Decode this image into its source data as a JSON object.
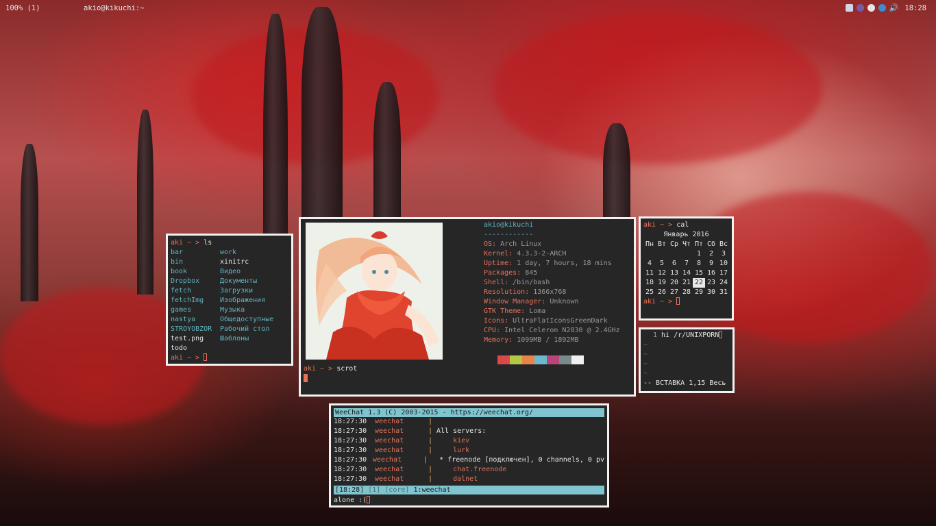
{
  "topbar": {
    "workspace": "100% (1)",
    "window_title": "akio@kikuchi:~",
    "clock": "18:28",
    "tray_icons": [
      "dropbox-icon",
      "viber-icon",
      "network-icon",
      "telegram-icon",
      "volume-icon"
    ]
  },
  "ls_term": {
    "prompt": "aki ~ >",
    "command": "ls",
    "items": [
      {
        "name": "bar",
        "type": "dir"
      },
      {
        "name": "work",
        "type": "dir"
      },
      {
        "name": "bin",
        "type": "dir"
      },
      {
        "name": "xinitrc",
        "type": "file"
      },
      {
        "name": "book",
        "type": "dir"
      },
      {
        "name": "Видео",
        "type": "dir"
      },
      {
        "name": "Dropbox",
        "type": "dir"
      },
      {
        "name": "Документы",
        "type": "dir"
      },
      {
        "name": "fetch",
        "type": "dir"
      },
      {
        "name": "Загрузки",
        "type": "dir"
      },
      {
        "name": "fetchImg",
        "type": "dir"
      },
      {
        "name": "Изображения",
        "type": "dir"
      },
      {
        "name": "games",
        "type": "dir"
      },
      {
        "name": "Музыка",
        "type": "dir"
      },
      {
        "name": "nastya",
        "type": "dir"
      },
      {
        "name": "Общедоступные",
        "type": "dir"
      },
      {
        "name": "STROYOBZOR",
        "type": "dir"
      },
      {
        "name": "Рабочий стол",
        "type": "dir"
      },
      {
        "name": "test.png",
        "type": "file"
      },
      {
        "name": "Шаблоны",
        "type": "dir"
      },
      {
        "name": "todo",
        "type": "file"
      },
      {
        "name": "",
        "type": "file"
      }
    ],
    "prompt2": "aki ~ >"
  },
  "neofetch": {
    "user_host": "akio@kikuchi",
    "separator": "------------",
    "fields": [
      {
        "key": "OS:",
        "value": "Arch Linux"
      },
      {
        "key": "Kernel:",
        "value": "4.3.3-2-ARCH"
      },
      {
        "key": "Uptime:",
        "value": "1 day, 7 hours, 18 mins"
      },
      {
        "key": "Packages:",
        "value": "845"
      },
      {
        "key": "Shell:",
        "value": "/bin/bash"
      },
      {
        "key": "Resolution:",
        "value": "1366x768"
      },
      {
        "key": "Window Manager:",
        "value": "Unknown"
      },
      {
        "key": "GTK Theme:",
        "value": "Loma"
      },
      {
        "key": "Icons:",
        "value": "UltraFlatIconsGreenDark"
      },
      {
        "key": "CPU:",
        "value": "Intel Celeron  N2830  @ 2.4GHz"
      },
      {
        "key": "Memory:",
        "value": "1099MB / 1892MB"
      }
    ],
    "swatches": [
      "#d9494a",
      "#b5c844",
      "#e8844a",
      "#6cb8cf",
      "#b8467a",
      "#7a8a8c",
      "#f0f0f0"
    ],
    "prompt": "aki ~ >",
    "command": "scrot"
  },
  "cal_term": {
    "prompt": "aki ~ >",
    "command": "cal",
    "month_title": "Январь 2016",
    "weekdays": [
      "Пн",
      "Вт",
      "Ср",
      "Чт",
      "Пт",
      "Сб",
      "Вс"
    ],
    "cells": [
      "",
      "",
      "",
      "",
      "1",
      "2",
      "3",
      "4",
      "5",
      "6",
      "7",
      "8",
      "9",
      "10",
      "11",
      "12",
      "13",
      "14",
      "15",
      "16",
      "17",
      "18",
      "19",
      "20",
      "21",
      "22",
      "23",
      "24",
      "25",
      "26",
      "27",
      "28",
      "29",
      "30",
      "31"
    ],
    "today": "22",
    "prompt2": "aki ~ >"
  },
  "vim": {
    "line_number": "1",
    "line_text": "hi /r/UNIXPORN",
    "tildes": [
      "~",
      "~",
      "~",
      "~"
    ],
    "statusline": "-- ВСТАВКА 1,15 Весь"
  },
  "weechat": {
    "header": "WeeChat 1.3 (C) 2003-2015 - https://weechat.org/",
    "lines": [
      {
        "time": "18:27:30",
        "nick": "weechat",
        "msg": ""
      },
      {
        "time": "18:27:30",
        "nick": "weechat",
        "msg": "All servers:"
      },
      {
        "time": "18:27:30",
        "nick": "weechat",
        "msg": "    kiev"
      },
      {
        "time": "18:27:30",
        "nick": "weechat",
        "msg": "    lurk"
      },
      {
        "time": "18:27:30",
        "nick": "weechat",
        "msg": "  * freenode [подключен], 0 channels, 0 pv"
      },
      {
        "time": "18:27:30",
        "nick": "weechat",
        "msg": "    chat.freenode"
      },
      {
        "time": "18:27:30",
        "nick": "weechat",
        "msg": "    dalnet"
      }
    ],
    "status": {
      "time": "[18:28]",
      "buf": "[1]",
      "core": "[core]",
      "name": "1:weechat"
    },
    "input": "alone :("
  }
}
